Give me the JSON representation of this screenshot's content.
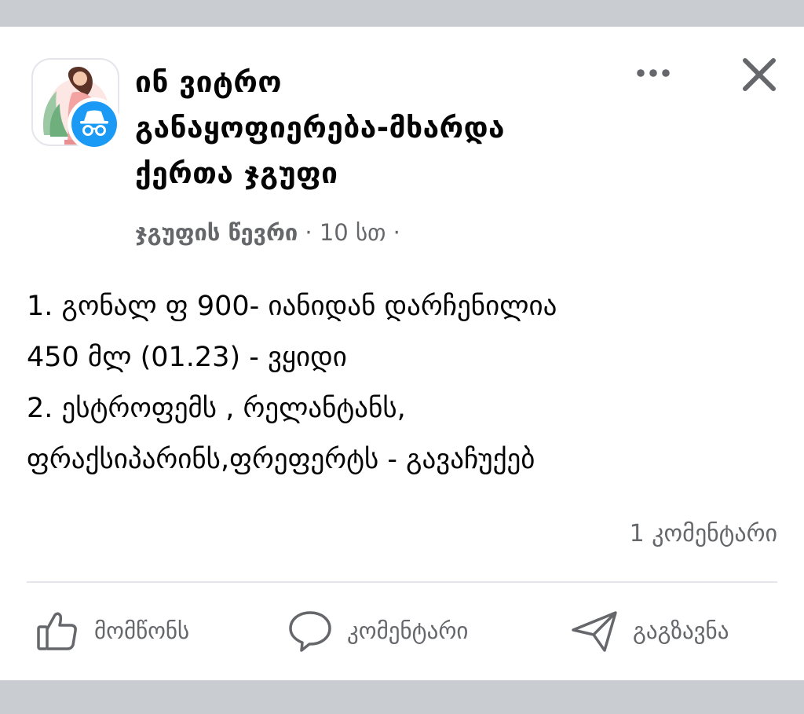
{
  "post": {
    "group_name_lines": [
      "ინ ვიტრო",
      "განაყოფიერება-მხარდა",
      "ქერთა ჯგუფი"
    ],
    "author": "ჯგუფის წევრი",
    "separator": "·",
    "time": "10 სთ",
    "body_lines": [
      "1. გონალ ფ 900- იანიდან დარჩენილია",
      "450 მლ (01.23) - ვყიდი",
      "2. ესტროფემს , რელანტანს,",
      "ფრაქსიპარინს,ფრეფერტს - გავაჩუქებ"
    ],
    "comments_count": "1 კომენტარი"
  },
  "actions": {
    "like": "მომწონს",
    "comment": "კომენტარი",
    "share": "გაგზავნა"
  },
  "icons": {
    "more": "more-horizontal-icon",
    "close": "close-icon",
    "like": "thumbs-up-icon",
    "comment": "speech-bubble-icon",
    "share": "paper-plane-icon",
    "anonymous": "incognito-icon"
  },
  "colors": {
    "background": "#c9ccd1",
    "card": "#ffffff",
    "text": "#050505",
    "secondary_text": "#65676b",
    "badge_blue": "#1b9af5"
  }
}
